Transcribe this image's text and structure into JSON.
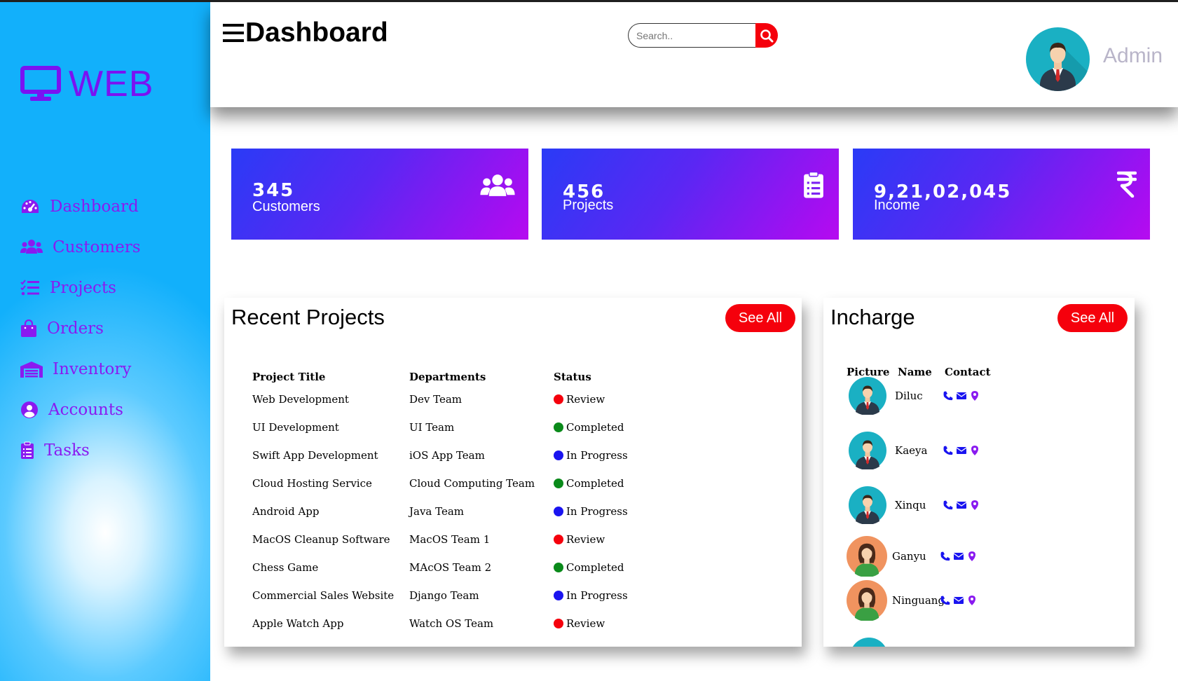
{
  "brand": {
    "name": "WEB",
    "icon": "desktop-icon"
  },
  "sidebar": {
    "items": [
      {
        "label": "Dashboard",
        "icon": "gauge-icon"
      },
      {
        "label": "Customers",
        "icon": "users-icon"
      },
      {
        "label": "Projects",
        "icon": "list-check-icon"
      },
      {
        "label": "Orders",
        "icon": "shopping-bag-icon"
      },
      {
        "label": "Inventory",
        "icon": "warehouse-icon"
      },
      {
        "label": "Accounts",
        "icon": "user-circle-icon"
      },
      {
        "label": "Tasks",
        "icon": "clipboard-icon"
      }
    ]
  },
  "header": {
    "title": "Dashboard",
    "search_placeholder": "Search..",
    "user_name": "Admin"
  },
  "cards": [
    {
      "value": "345",
      "label": "Customers",
      "icon": "users-icon"
    },
    {
      "value": "456",
      "label": "Projects",
      "icon": "clipboard-list-icon"
    },
    {
      "value": "9,21,02,045",
      "label": "Income",
      "icon": "rupee-icon"
    }
  ],
  "recent_projects": {
    "title": "Recent Projects",
    "see_all": "See All",
    "columns": [
      "Project Title",
      "Departments",
      "Status"
    ],
    "rows": [
      {
        "title": "Web Development",
        "department": "Dev Team",
        "status": "Review"
      },
      {
        "title": "UI Development",
        "department": "UI Team",
        "status": "Completed"
      },
      {
        "title": "Swift App Development",
        "department": "iOS App Team",
        "status": "In Progress"
      },
      {
        "title": "Cloud Hosting Service",
        "department": "Cloud Computing Team",
        "status": "Completed"
      },
      {
        "title": "Android App",
        "department": "Java Team",
        "status": "In Progress"
      },
      {
        "title": "MacOS Cleanup Software",
        "department": "MacOS Team 1",
        "status": "Review"
      },
      {
        "title": "Chess Game",
        "department": "MAcOS Team 2",
        "status": "Completed"
      },
      {
        "title": "Commercial Sales Website",
        "department": "Django Team",
        "status": "In Progress"
      },
      {
        "title": "Apple Watch App",
        "department": "Watch OS Team",
        "status": "Review"
      }
    ]
  },
  "status_colors": {
    "Review": "#f5000c",
    "Completed": "#0a8a1a",
    "In Progress": "#1a14f0"
  },
  "incharge": {
    "title": "Incharge",
    "see_all": "See All",
    "columns": [
      "Picture",
      "Name",
      "Contact"
    ],
    "people": [
      {
        "name": "Diluc",
        "avatar": "male-avatar"
      },
      {
        "name": "Kaeya",
        "avatar": "male-avatar"
      },
      {
        "name": "Xinqu",
        "avatar": "male-avatar"
      },
      {
        "name": "Ganyu",
        "avatar": "female-avatar"
      },
      {
        "name": "Ninguang",
        "avatar": "female-avatar"
      }
    ]
  },
  "colors": {
    "accent": "#8a1af0",
    "primary_red": "#f5000c",
    "sidebar_blue": "#12b0fb"
  }
}
